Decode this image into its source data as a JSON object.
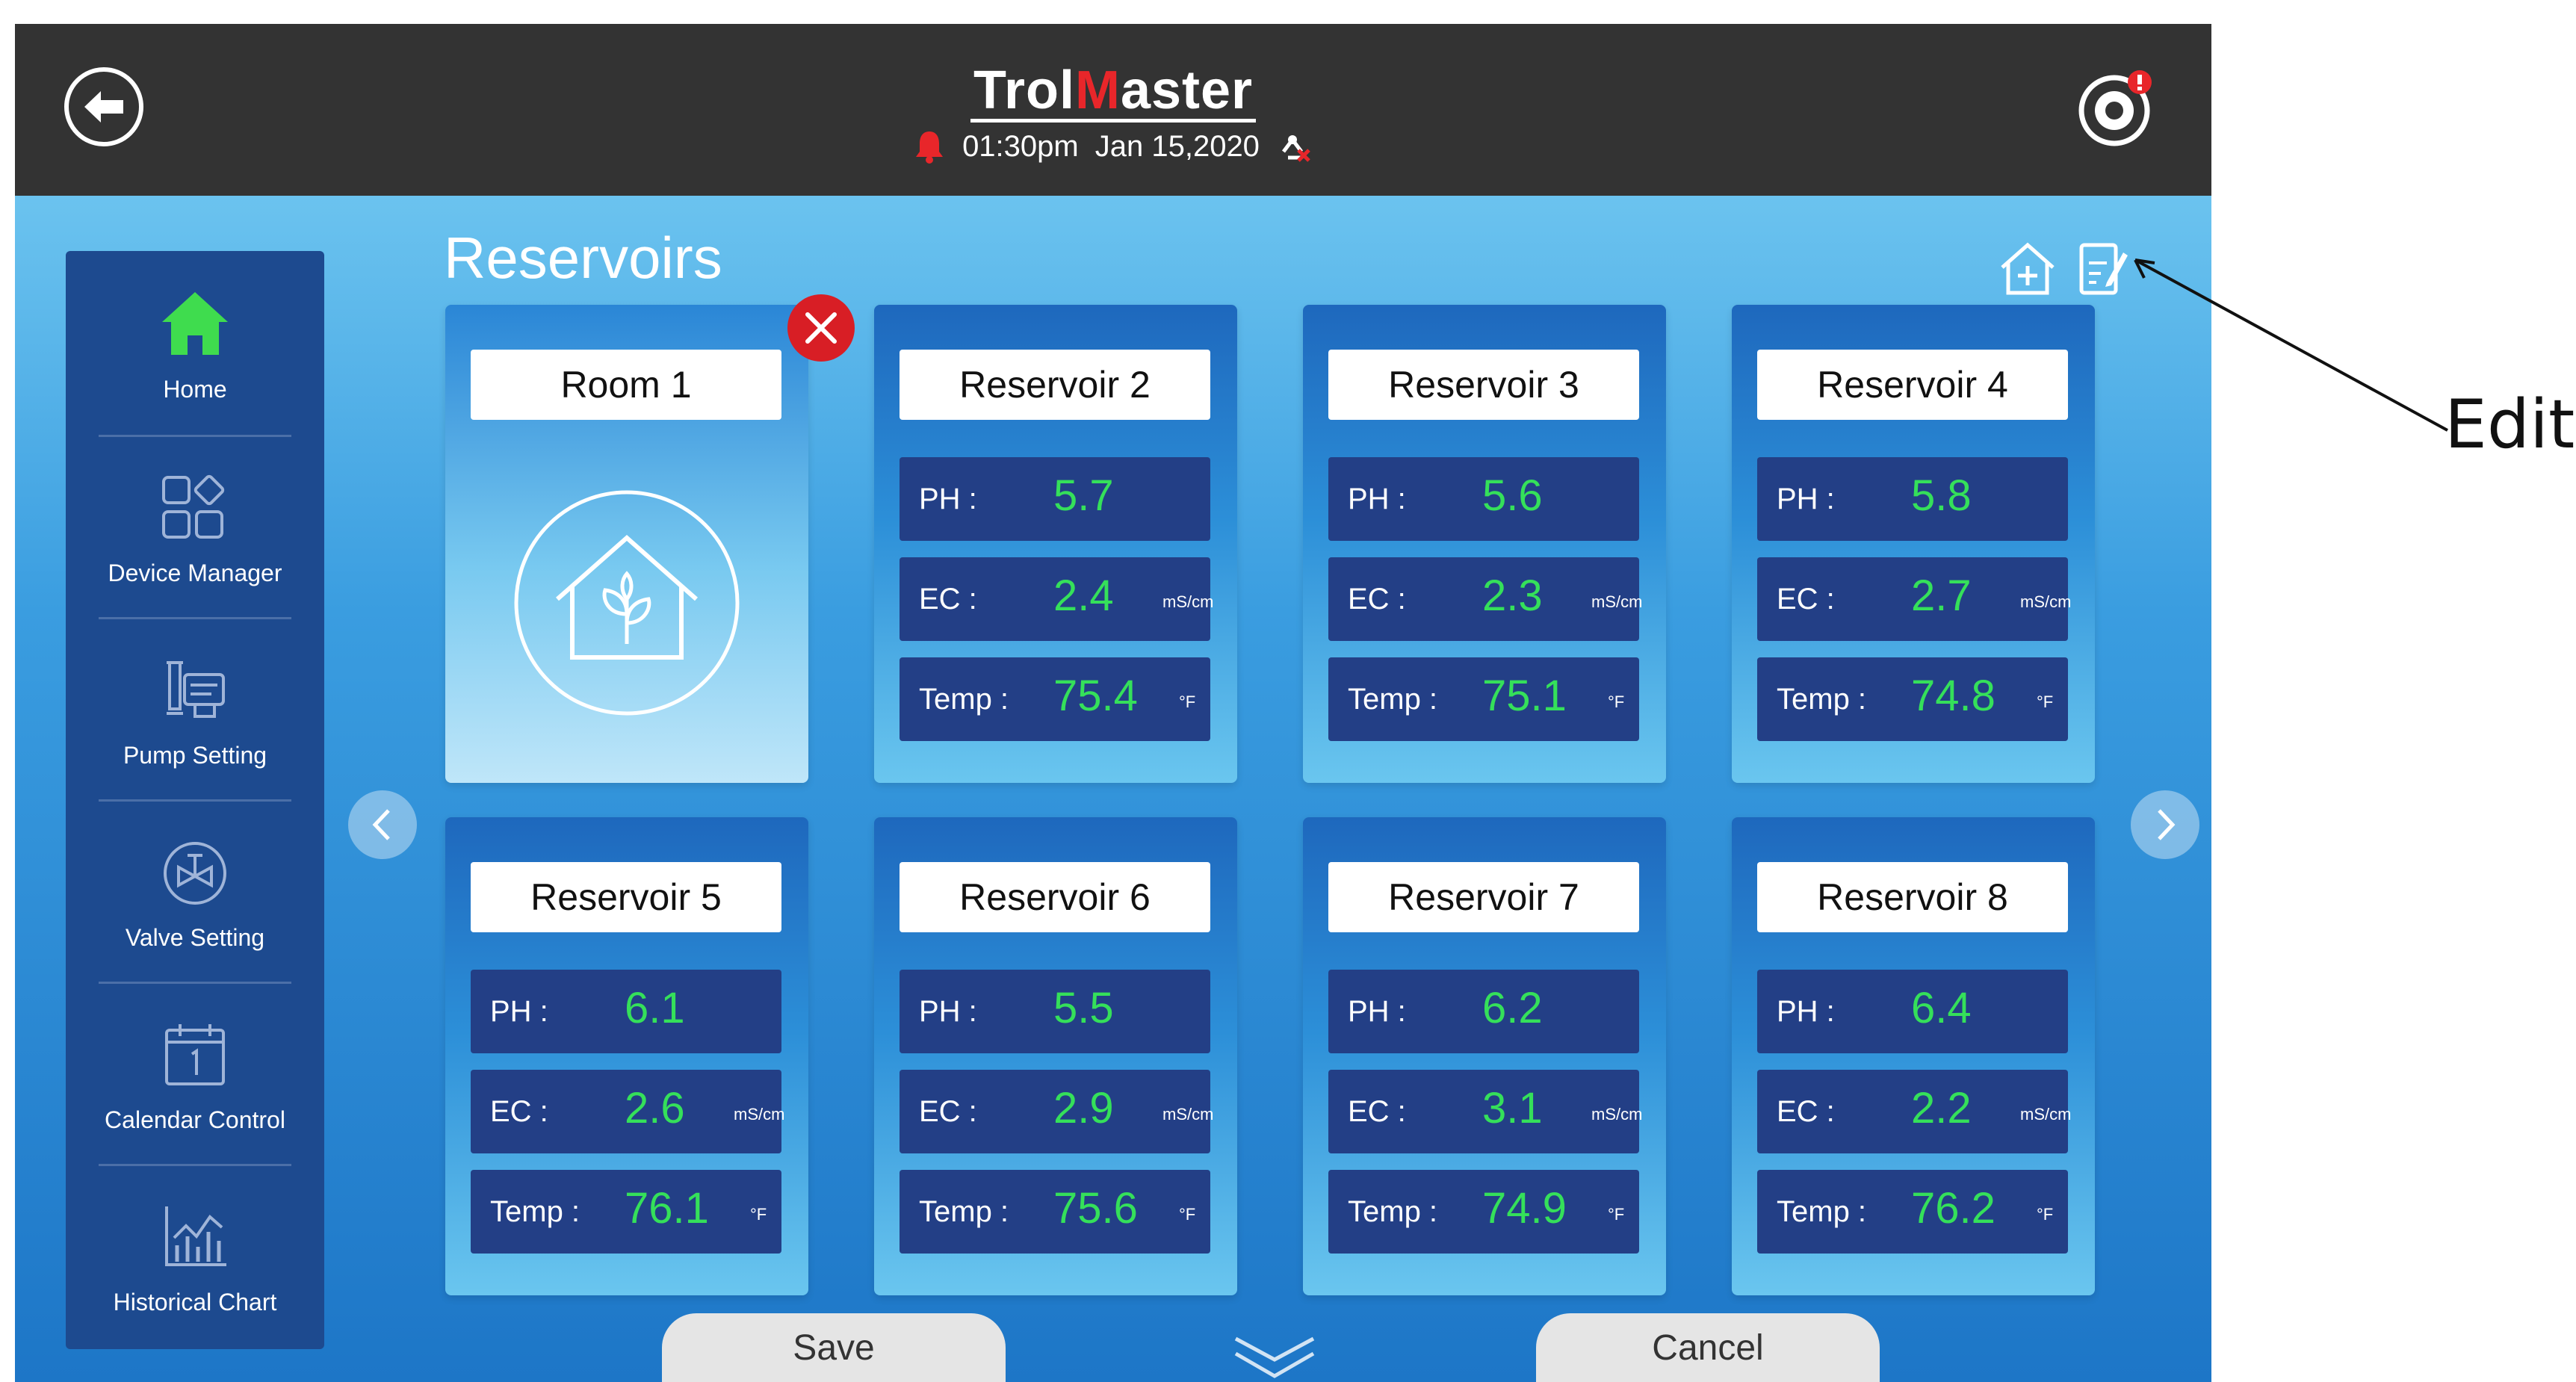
{
  "header": {
    "logo_text": "TrolMaster",
    "time": "01:30pm",
    "date": "Jan 15,2020",
    "back_icon": "back-arrow-icon",
    "settings_icon": "settings-alert-icon",
    "alarm_icon": "bell-icon",
    "wifi_icon": "no-connection-icon"
  },
  "sidebar": {
    "items": [
      {
        "label": "Home",
        "icon": "home-icon",
        "active": true
      },
      {
        "label": "Device Manager",
        "icon": "device-manager-icon"
      },
      {
        "label": "Pump Setting",
        "icon": "pump-icon"
      },
      {
        "label": "Valve Setting",
        "icon": "valve-icon"
      },
      {
        "label": "Calendar Control",
        "icon": "calendar-icon"
      },
      {
        "label": "Historical Chart",
        "icon": "chart-icon"
      }
    ]
  },
  "main": {
    "title": "Reservoirs",
    "room_card": {
      "title": "Room 1"
    },
    "labels": {
      "ph": "PH :",
      "ec": "EC :",
      "temp": "Temp :",
      "ec_unit": "mS/cm",
      "temp_unit": "°F"
    },
    "reservoirs": [
      {
        "name": "Reservoir 2",
        "ph": "5.7",
        "ec": "2.4",
        "temp": "75.4"
      },
      {
        "name": "Reservoir 3",
        "ph": "5.6",
        "ec": "2.3",
        "temp": "75.1"
      },
      {
        "name": "Reservoir 4",
        "ph": "5.8",
        "ec": "2.7",
        "temp": "74.8"
      },
      {
        "name": "Reservoir 5",
        "ph": "6.1",
        "ec": "2.6",
        "temp": "76.1"
      },
      {
        "name": "Reservoir 6",
        "ph": "5.5",
        "ec": "2.9",
        "temp": "75.6"
      },
      {
        "name": "Reservoir 7",
        "ph": "6.2",
        "ec": "3.1",
        "temp": "74.9"
      },
      {
        "name": "Reservoir 8",
        "ph": "6.4",
        "ec": "2.2",
        "temp": "76.2"
      }
    ]
  },
  "footer": {
    "save_label": "Save",
    "cancel_label": "Cancel"
  },
  "annotation": {
    "label": "Edit"
  },
  "colors": {
    "value_green": "#35e05a",
    "delete_red": "#d81e25",
    "home_green": "#3fdc4e",
    "alert_red": "#e8262a"
  }
}
